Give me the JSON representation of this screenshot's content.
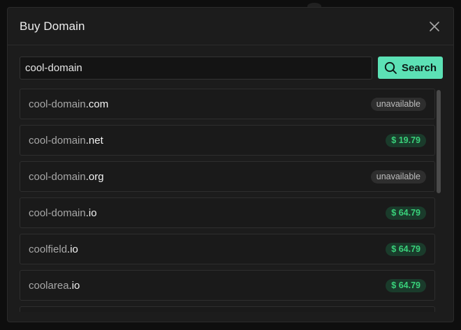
{
  "modal": {
    "title": "Buy Domain"
  },
  "search": {
    "value": "cool-domain",
    "button_label": "Search"
  },
  "results": [
    {
      "base": "cool-domain",
      "tld": ".com",
      "status": "unavailable",
      "badge": "unavailable"
    },
    {
      "base": "cool-domain",
      "tld": ".net",
      "status": "available",
      "badge": "$ 19.79"
    },
    {
      "base": "cool-domain",
      "tld": ".org",
      "status": "unavailable",
      "badge": "unavailable"
    },
    {
      "base": "cool-domain",
      "tld": ".io",
      "status": "available",
      "badge": "$ 64.79"
    },
    {
      "base": "coolfield",
      "tld": ".io",
      "status": "available",
      "badge": "$ 64.79"
    },
    {
      "base": "coolarea",
      "tld": ".io",
      "status": "available",
      "badge": "$ 64.79"
    },
    {
      "base": "",
      "tld": "",
      "status": "",
      "badge": ""
    }
  ],
  "colors": {
    "accent": "#5ce1b5",
    "price_text": "#39d17a",
    "price_bg": "#1a3b2b"
  },
  "icons": {
    "close": "close-icon",
    "search": "search-icon"
  }
}
